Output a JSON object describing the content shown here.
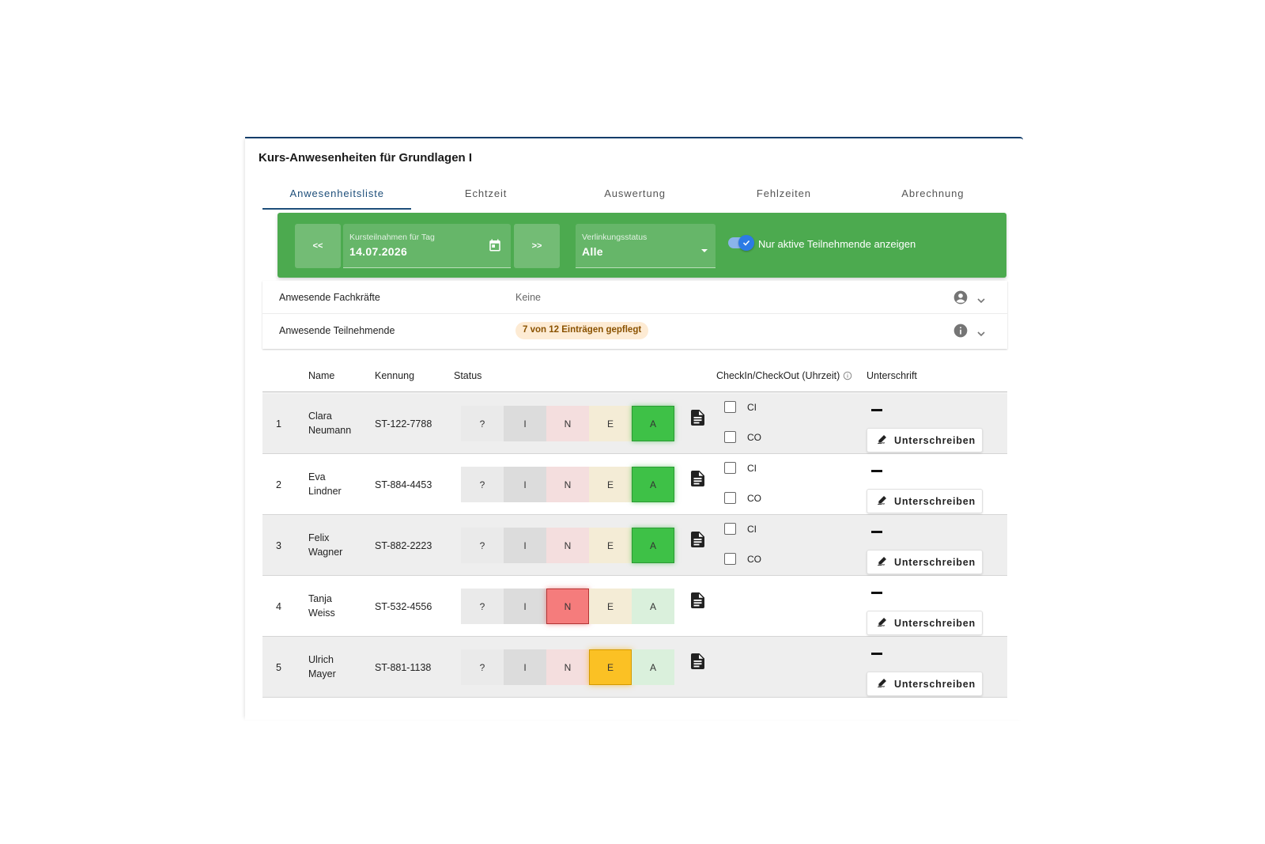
{
  "title": "Kurs-Anwesenheiten für Grundlagen I",
  "tabs": [
    {
      "label": "Anwesenheitsliste",
      "active": true
    },
    {
      "label": "Echtzeit"
    },
    {
      "label": "Auswertung"
    },
    {
      "label": "Fehlzeiten"
    },
    {
      "label": "Abrechnung"
    }
  ],
  "toolbar": {
    "prev_label": "<<",
    "next_label": ">>",
    "date_label": "Kursteilnahmen für Tag",
    "date_value": "14.07.2026",
    "link_label": "Verlinkungsstatus",
    "link_value": "Alle",
    "toggle_label": "Nur aktive Teilnehmende anzeigen",
    "toggle_on": true,
    "accent_color": "#4caa4f"
  },
  "info": {
    "staff_label": "Anwesende Fachkräfte",
    "staff_value": "Keine",
    "participants_label": "Anwesende Teilnehmende",
    "participants_chip": "7 von 12 Einträgen gepflegt"
  },
  "table": {
    "headers": {
      "name": "Name",
      "id": "Kennung",
      "status": "Status",
      "checkinout": "CheckIn/CheckOut (Uhrzeit)",
      "signature": "Unterschrift"
    },
    "status_options": [
      "?",
      "I",
      "N",
      "E",
      "A"
    ],
    "checkin_label": "CI",
    "checkout_label": "CO",
    "sign_label": "Unterschreiben",
    "rows": [
      {
        "num": "1",
        "first": "Clara",
        "last": "Neumann",
        "id": "ST-122-7788",
        "status": "A",
        "has_checkin": true
      },
      {
        "num": "2",
        "first": "Eva",
        "last": "Lindner",
        "id": "ST-884-4453",
        "status": "A",
        "has_checkin": true
      },
      {
        "num": "3",
        "first": "Felix",
        "last": "Wagner",
        "id": "ST-882-2223",
        "status": "A",
        "has_checkin": true
      },
      {
        "num": "4",
        "first": "Tanja",
        "last": "Weiss",
        "id": "ST-532-4556",
        "status": "N",
        "has_checkin": false
      },
      {
        "num": "5",
        "first": "Ulrich",
        "last": "Mayer",
        "id": "ST-881-1138",
        "status": "E",
        "has_checkin": false
      }
    ]
  }
}
